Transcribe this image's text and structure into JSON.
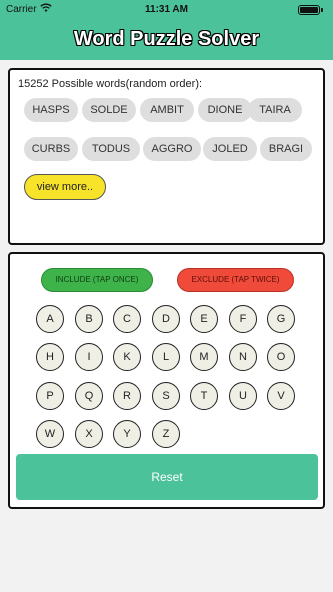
{
  "status_bar": {
    "carrier": "Carrier",
    "time": "11:31 AM"
  },
  "app_bar": {
    "title": "Word Puzzle Solver"
  },
  "words_panel": {
    "count_text": "15252 Possible words(random order):",
    "words": [
      "HASPS",
      "SOLDE",
      "AMBIT",
      "DIONE",
      "TAIRA",
      "CURBS",
      "TODUS",
      "AGGRO",
      "JOLED",
      "BRAGI"
    ],
    "view_more_label": "view more.."
  },
  "keyboard_panel": {
    "include_label": "INCLUDE (TAP ONCE)",
    "exclude_label": "EXCLUDE (TAP TWICE)",
    "letters": [
      "A",
      "B",
      "C",
      "D",
      "E",
      "F",
      "G",
      "H",
      "I",
      "K",
      "L",
      "M",
      "N",
      "O",
      "P",
      "Q",
      "R",
      "S",
      "T",
      "U",
      "V",
      "W",
      "X",
      "Y",
      "Z"
    ],
    "reset_label": "Reset"
  },
  "colors": {
    "accent": "#4cc29a",
    "include": "#3eb34a",
    "exclude": "#f04a3a",
    "view_more": "#f7e32a"
  }
}
